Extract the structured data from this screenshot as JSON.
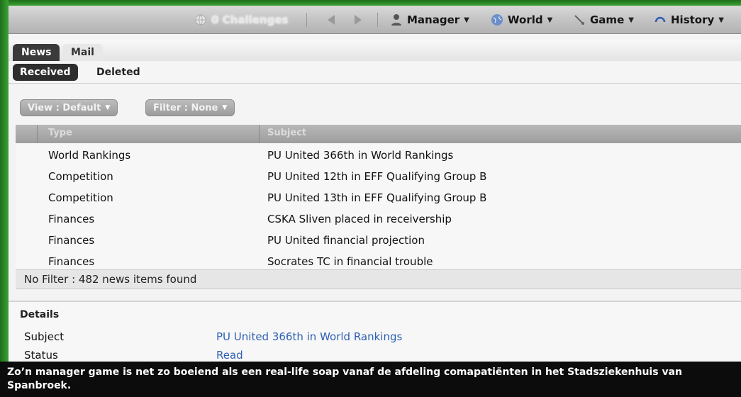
{
  "menubar": {
    "challenges_label": "0 Challenges",
    "manager_label": "Manager",
    "world_label": "World",
    "game_label": "Game",
    "history_label": "History"
  },
  "tabs": {
    "news": "News",
    "mail": "Mail"
  },
  "subtabs": {
    "received": "Received",
    "deleted": "Deleted"
  },
  "filters": {
    "view": "View : Default",
    "filter": "Filter : None"
  },
  "table": {
    "columns": [
      "Type",
      "Subject"
    ],
    "rows": [
      [
        "World Rankings",
        "PU United 366th in World Rankings"
      ],
      [
        "Competition",
        "PU United 12th in EFF Qualifying Group B"
      ],
      [
        "Competition",
        "PU United 13th in EFF Qualifying Group B"
      ],
      [
        "Finances",
        "CSKA Sliven  placed in receivership"
      ],
      [
        "Finances",
        "PU United financial projection"
      ],
      [
        "Finances",
        "Socrates TC in financial trouble"
      ]
    ],
    "status": "No Filter : 482 news items found"
  },
  "details": {
    "title": "Details",
    "subject_label": "Subject",
    "subject_value": "PU United 366th in World Rankings",
    "status_label": "Status",
    "status_value": "Read"
  },
  "caption": "Zo’n manager game is net zo boeiend als een real-life soap vanaf de afdeling comapatiënten in het Stadsziekenhuis van Spanbroek.",
  "colors": {
    "frame": "#2e8a2a",
    "link": "#2d5fb3",
    "caption_bg": "#0c0c0c"
  },
  "icons": [
    "globe-icon",
    "back-arrow-icon",
    "forward-arrow-icon",
    "manager-icon",
    "world-icon",
    "game-icon",
    "history-icon"
  ]
}
